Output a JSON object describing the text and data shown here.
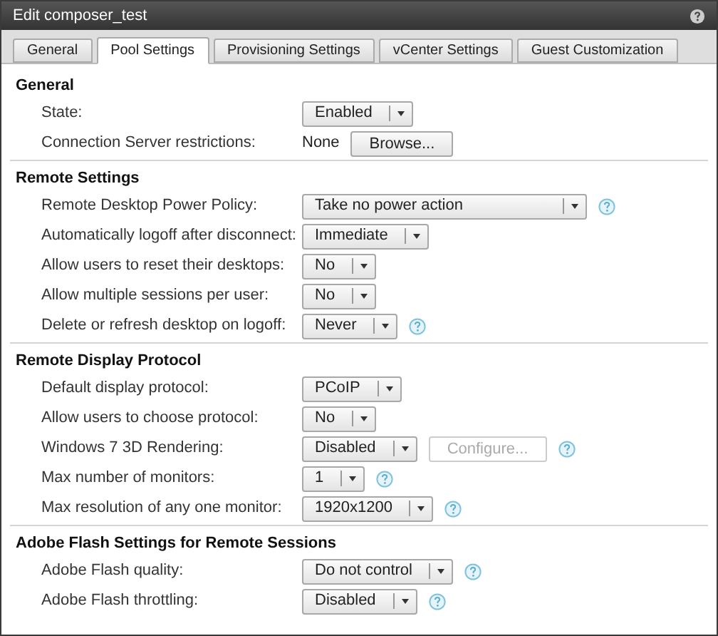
{
  "window": {
    "title": "Edit composer_test"
  },
  "tabs": [
    {
      "label": "General",
      "selected": false
    },
    {
      "label": "Pool Settings",
      "selected": true
    },
    {
      "label": "Provisioning Settings",
      "selected": false
    },
    {
      "label": "vCenter Settings",
      "selected": false
    },
    {
      "label": "Guest Customization",
      "selected": false
    }
  ],
  "sections": [
    {
      "title": "General",
      "rows": [
        {
          "kind": "select",
          "label": "State:",
          "value": "Enabled",
          "help": false
        },
        {
          "kind": "text_button",
          "label": "Connection Server restrictions:",
          "text": "None",
          "button": {
            "label": "Browse...",
            "disabled": false
          },
          "help": false
        }
      ]
    },
    {
      "title": "Remote Settings",
      "rows": [
        {
          "kind": "select",
          "label": "Remote Desktop Power Policy:",
          "value": "Take no power action",
          "help": true
        },
        {
          "kind": "select",
          "label": "Automatically logoff after disconnect:",
          "value": "Immediate",
          "help": false
        },
        {
          "kind": "select",
          "label": "Allow users to reset their desktops:",
          "value": "No",
          "help": false
        },
        {
          "kind": "select",
          "label": "Allow multiple sessions per user:",
          "value": "No",
          "help": false
        },
        {
          "kind": "select",
          "label": "Delete or refresh desktop on logoff:",
          "value": "Never",
          "help": true
        }
      ]
    },
    {
      "title": "Remote Display Protocol",
      "rows": [
        {
          "kind": "select",
          "label": "Default display protocol:",
          "value": "PCoIP",
          "help": false
        },
        {
          "kind": "select",
          "label": "Allow users to choose protocol:",
          "value": "No",
          "help": false
        },
        {
          "kind": "select_button",
          "label": "Windows 7 3D Rendering:",
          "value": "Disabled",
          "button": {
            "label": "Configure...",
            "disabled": true
          },
          "help": true
        },
        {
          "kind": "select",
          "label": "Max number of monitors:",
          "value": "1",
          "help": true
        },
        {
          "kind": "select",
          "label": "Max resolution of any one monitor:",
          "value": "1920x1200",
          "help": true
        }
      ]
    },
    {
      "title": "Adobe Flash Settings for Remote Sessions",
      "rows": [
        {
          "kind": "select",
          "label": "Adobe Flash quality:",
          "value": "Do not control",
          "help": true
        },
        {
          "kind": "select",
          "label": "Adobe Flash throttling:",
          "value": "Disabled",
          "help": true
        }
      ]
    }
  ]
}
